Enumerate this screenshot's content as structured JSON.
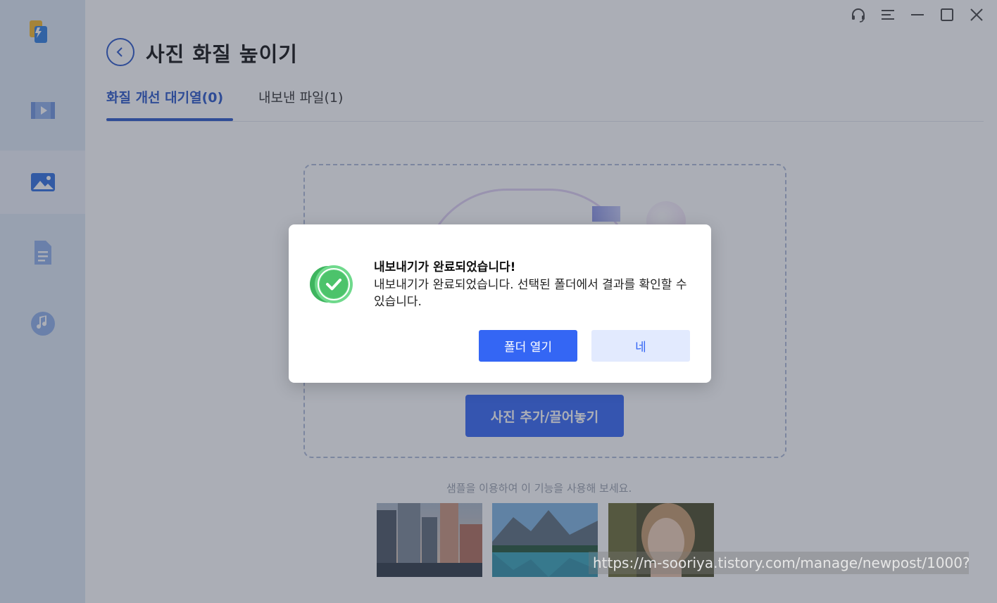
{
  "header": {
    "title": "사진 화질 높이기"
  },
  "tabs": [
    {
      "label": "화질 개선 대기열(0)",
      "active": true
    },
    {
      "label": "내보낸 파일(1)",
      "active": false
    }
  ],
  "sidebar": {
    "items": [
      {
        "icon": "video-icon"
      },
      {
        "icon": "image-icon",
        "active": true
      },
      {
        "icon": "document-icon"
      },
      {
        "icon": "music-icon"
      }
    ]
  },
  "window_controls": [
    "headset-icon",
    "menu-icon",
    "minimize-icon",
    "maximize-icon",
    "close-icon"
  ],
  "dropzone": {
    "add_button_label": "사진 추가/끌어놓기"
  },
  "samples": {
    "hint": "샘플을 이용하여 이 기능을 사용해 보세요."
  },
  "dialog": {
    "title": "내보내기가 완료되었습니다!",
    "message": "내보내기가 완료되었습니다. 선택된 폴더에서 결과를 확인할 수 있습니다.",
    "open_folder_label": "폴더 열기",
    "confirm_label": "네"
  },
  "watermark": {
    "url": "https://m-sooriya.tistory.com/manage/newpost/1000?"
  },
  "colors": {
    "accent": "#3466f4",
    "accent_dark": "#2a57c9",
    "success": "#4cc36b",
    "sidebar_bg": "#dfe8f5"
  }
}
